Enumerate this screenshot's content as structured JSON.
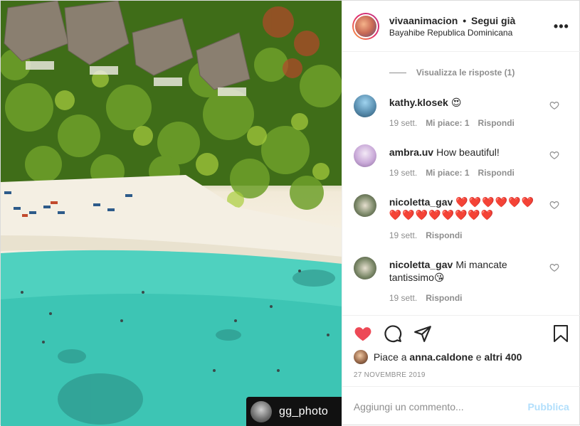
{
  "photo": {
    "watermark_text": "gg_photo"
  },
  "header": {
    "username": "vivaanimacion",
    "separator": "•",
    "follow_status": "Segui già",
    "location": "Bayahibe Republica Dominicana",
    "more_icon": "more-horizontal-icon"
  },
  "comments": {
    "view_replies": "Visualizza le risposte (1)",
    "items": [
      {
        "user": "kathy.klosek",
        "text": "😍",
        "time": "19 sett.",
        "likes": "Mi piace: 1",
        "reply": "Rispondi"
      },
      {
        "user": "ambra.uv",
        "text": "How beautiful!",
        "time": "19 sett.",
        "likes": "Mi piace: 1",
        "reply": "Rispondi"
      },
      {
        "user": "nicoletta_gav",
        "text": "❤️❤️❤️❤️❤️❤️❤️❤️❤️❤️❤️❤️❤️❤️",
        "time": "19 sett.",
        "reply": "Rispondi"
      },
      {
        "user": "nicoletta_gav",
        "text": "Mi mancate tantissimo😘",
        "time": "19 sett.",
        "reply": "Rispondi"
      }
    ]
  },
  "actions": {
    "likes_prefix": "Piace a",
    "likes_user": "anna.caldone",
    "likes_conj": "e",
    "likes_others": "altri 400",
    "date": "27 NOVEMBRE 2019"
  },
  "add_comment": {
    "placeholder": "Aggiungi un commento...",
    "publish": "Pubblica"
  },
  "colors": {
    "like_red": "#ed4956",
    "publish_blue": "#b2dffc",
    "meta_gray": "#8e8e8e"
  }
}
